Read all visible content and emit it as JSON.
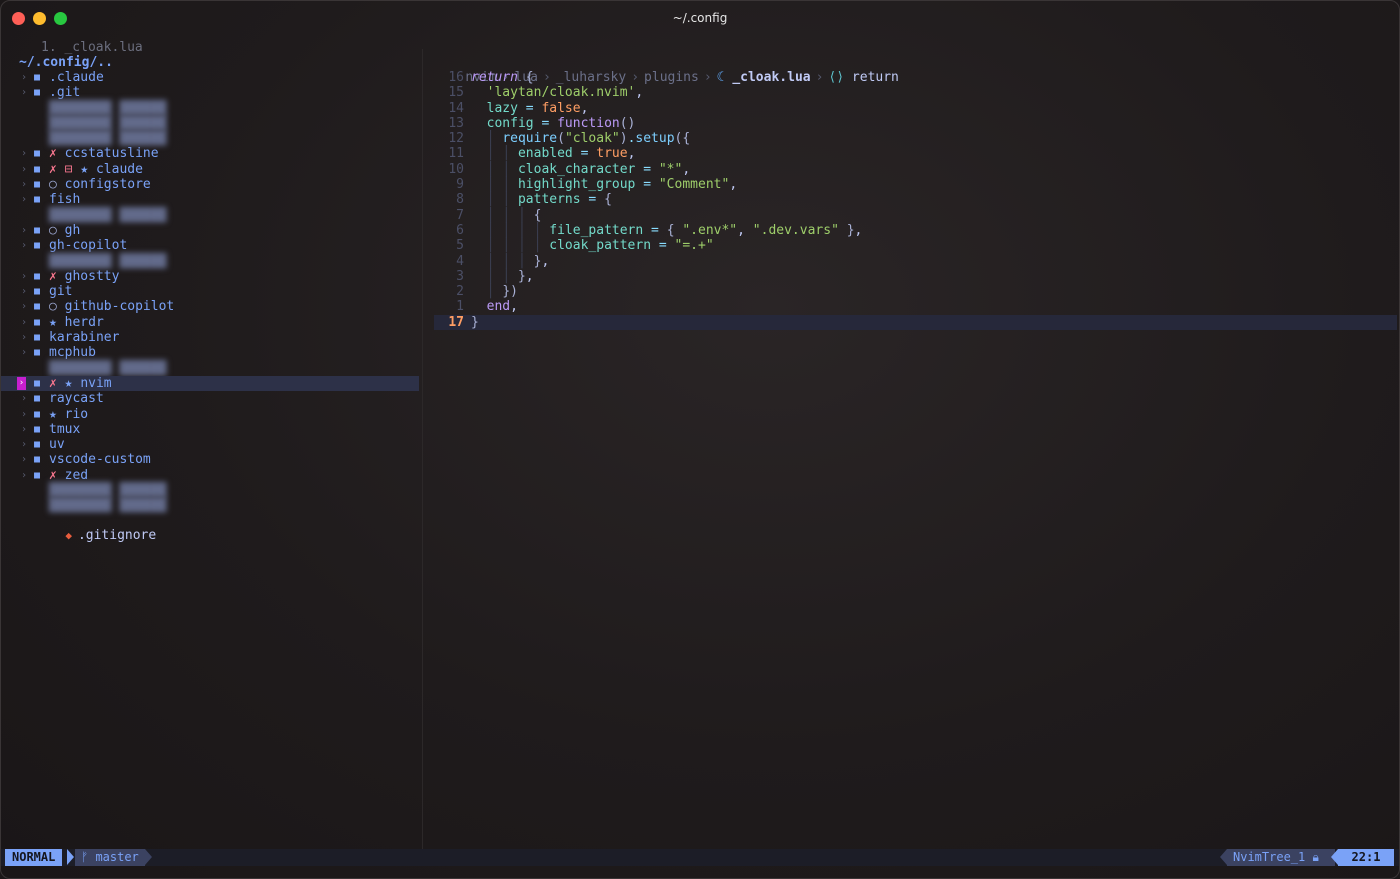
{
  "window": {
    "title": "~/.config"
  },
  "buffer_line": "1. _cloak.lua",
  "tree": {
    "root": "~/.config/..",
    "rows": [
      {
        "name": ".claude",
        "git": "",
        "kind": "dir"
      },
      {
        "name": ".git",
        "git": "",
        "kind": "dir"
      },
      {
        "name": "",
        "git": "",
        "kind": "blur"
      },
      {
        "name": "",
        "git": "",
        "kind": "blur"
      },
      {
        "name": "",
        "git": "",
        "kind": "blur"
      },
      {
        "name": "ccstatusline",
        "git": "✗",
        "kind": "dir"
      },
      {
        "name": "claude",
        "git": "✗ ⊟ ★",
        "kind": "dir"
      },
      {
        "name": "configstore",
        "git": "○",
        "kind": "dir"
      },
      {
        "name": "fish",
        "git": "",
        "kind": "dir"
      },
      {
        "name": "",
        "git": "",
        "kind": "blur"
      },
      {
        "name": "gh",
        "git": "○",
        "kind": "dir"
      },
      {
        "name": "gh-copilot",
        "git": "",
        "kind": "dir"
      },
      {
        "name": "",
        "git": "",
        "kind": "blur"
      },
      {
        "name": "ghostty",
        "git": "✗",
        "kind": "dir"
      },
      {
        "name": "git",
        "git": "",
        "kind": "dir"
      },
      {
        "name": "github-copilot",
        "git": "○",
        "kind": "dir"
      },
      {
        "name": "herdr",
        "git": "★",
        "kind": "dir"
      },
      {
        "name": "karabiner",
        "git": "",
        "kind": "dir"
      },
      {
        "name": "mcphub",
        "git": "",
        "kind": "dir"
      },
      {
        "name": "",
        "git": "",
        "kind": "blur"
      },
      {
        "name": "nvim",
        "git": "✗ ★",
        "kind": "dir",
        "selected": true
      },
      {
        "name": "raycast",
        "git": "",
        "kind": "dir"
      },
      {
        "name": "rio",
        "git": "★",
        "kind": "dir"
      },
      {
        "name": "tmux",
        "git": "",
        "kind": "dir"
      },
      {
        "name": "uv",
        "git": "",
        "kind": "dir"
      },
      {
        "name": "vscode-custom",
        "git": "",
        "kind": "dir"
      },
      {
        "name": "zed",
        "git": "✗",
        "kind": "dir"
      },
      {
        "name": "",
        "git": "",
        "kind": "blur"
      },
      {
        "name": "",
        "git": "",
        "kind": "blur"
      }
    ],
    "file": ".gitignore"
  },
  "breadcrumb": {
    "items": [
      "nvim",
      "lua",
      "_luharsky",
      "plugins"
    ],
    "file": "_cloak.lua",
    "symbol": "return"
  },
  "code": {
    "lines": [
      {
        "num": "16"
      },
      {
        "num": "15"
      },
      {
        "num": "14"
      },
      {
        "num": "13"
      },
      {
        "num": "12"
      },
      {
        "num": "11"
      },
      {
        "num": "10"
      },
      {
        "num": "9"
      },
      {
        "num": "8"
      },
      {
        "num": "7"
      },
      {
        "num": "6"
      },
      {
        "num": "5"
      },
      {
        "num": "4"
      },
      {
        "num": "3"
      },
      {
        "num": "2"
      },
      {
        "num": "1"
      },
      {
        "num": "17"
      }
    ]
  },
  "statusline": {
    "mode": "NORMAL",
    "branch": "master",
    "filetype": "NvimTree_1",
    "position": "22:1"
  },
  "colors": {
    "accent": "#7aa2f7",
    "cursor": "#c71fcf",
    "string": "#9ece6a",
    "keyword": "#bb9af7",
    "boolean": "#ff9e64"
  }
}
